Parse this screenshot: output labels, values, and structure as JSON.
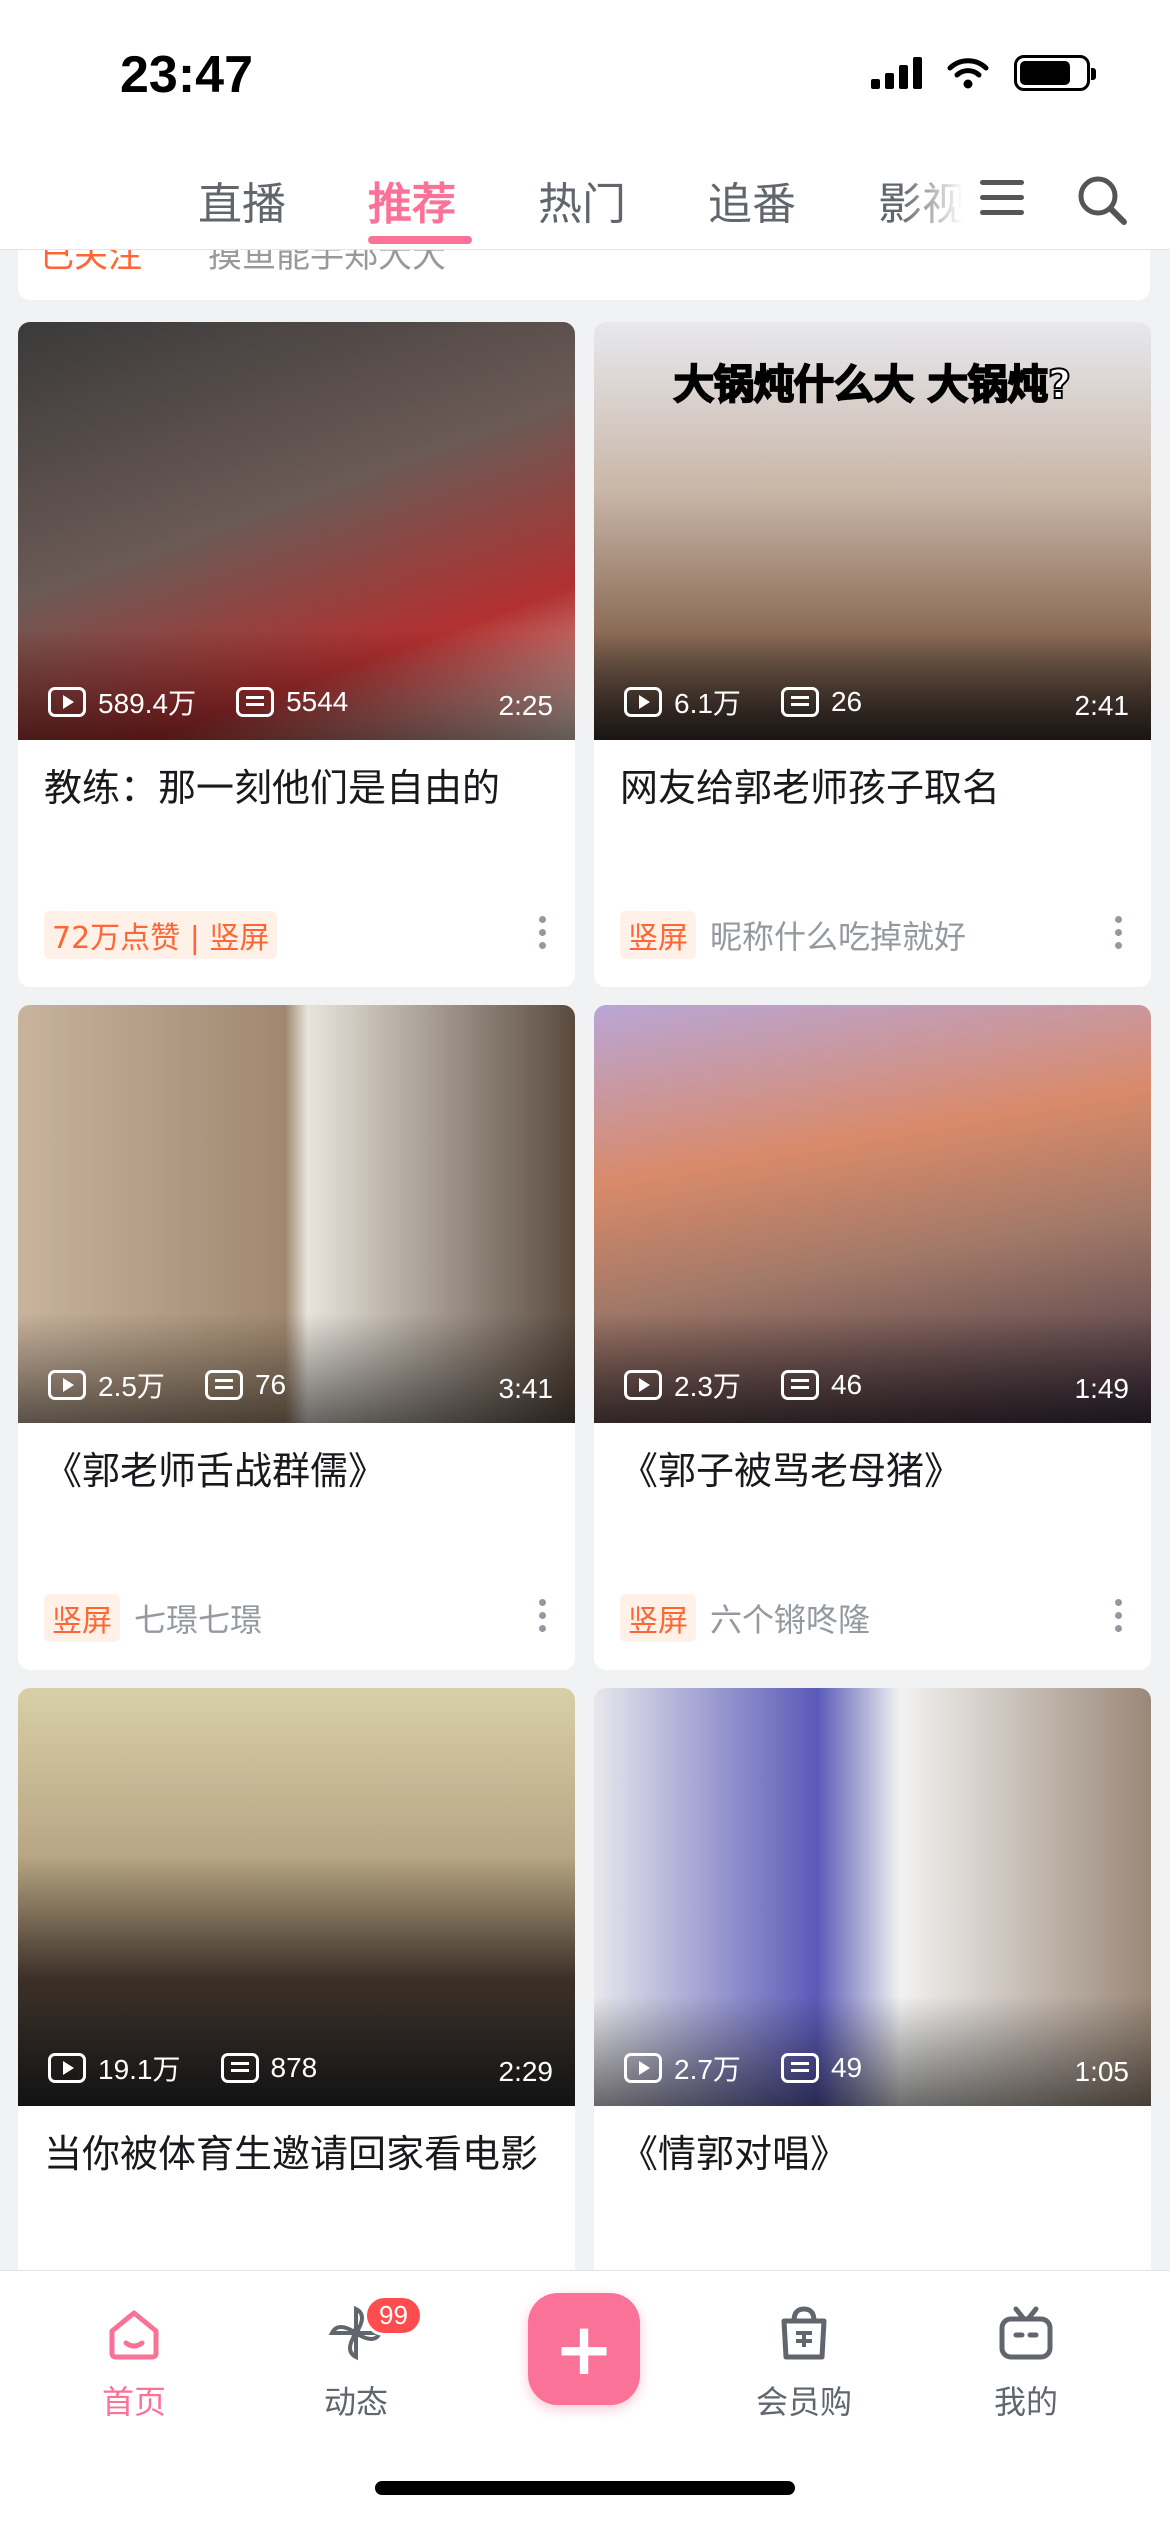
{
  "status_bar": {
    "time": "23:47"
  },
  "tabs": [
    {
      "label": "直播"
    },
    {
      "label": "推荐",
      "active": true
    },
    {
      "label": "热门"
    },
    {
      "label": "追番"
    },
    {
      "label": "影视"
    }
  ],
  "prev_card": {
    "tag": "已关注",
    "text": "摸鱼能手郑大大"
  },
  "cards": [
    {
      "plays": "589.4万",
      "danmaku": "5544",
      "duration": "2:25",
      "title": "教练：那一刻他们是自由的",
      "tags": [
        "72万点赞 | 竖屏"
      ],
      "foot": "",
      "thumb_color": "#6b5a55"
    },
    {
      "plays": "6.1万",
      "danmaku": "26",
      "duration": "2:41",
      "title": "网友给郭老师孩子取名",
      "tags": [
        "竖屏"
      ],
      "foot": "昵称什么吃掉就好",
      "thumb_caption": "大锅炖什么大 大锅炖?",
      "thumb_color": "#8a8c99"
    },
    {
      "plays": "2.5万",
      "danmaku": "76",
      "duration": "3:41",
      "title": "《郭老师舌战群儒》",
      "tags": [
        "竖屏"
      ],
      "foot": "七璟七璟",
      "thumb_color": "#8b7f6f"
    },
    {
      "plays": "2.3万",
      "danmaku": "46",
      "duration": "1:49",
      "title": "《郭子被骂老母猪》",
      "tags": [
        "竖屏"
      ],
      "foot": "六个锵咚隆",
      "thumb_color": "#9c7a8f"
    },
    {
      "plays": "19.1万",
      "danmaku": "878",
      "duration": "2:29",
      "title": "当你被体育生邀请回家看电影",
      "tags": [],
      "foot": "",
      "thumb_color": "#7c6e5a"
    },
    {
      "plays": "2.7万",
      "danmaku": "49",
      "duration": "1:05",
      "title": "《情郭对唱》",
      "tags": [],
      "foot": "",
      "thumb_color": "#8e8ea6"
    }
  ],
  "bottom_nav": [
    {
      "label": "首页",
      "active": true
    },
    {
      "label": "动态",
      "badge": "99"
    },
    {
      "label": "会员购"
    },
    {
      "label": "我的"
    }
  ],
  "colors": {
    "accent": "#fb7299",
    "tag": "#ff6633"
  }
}
